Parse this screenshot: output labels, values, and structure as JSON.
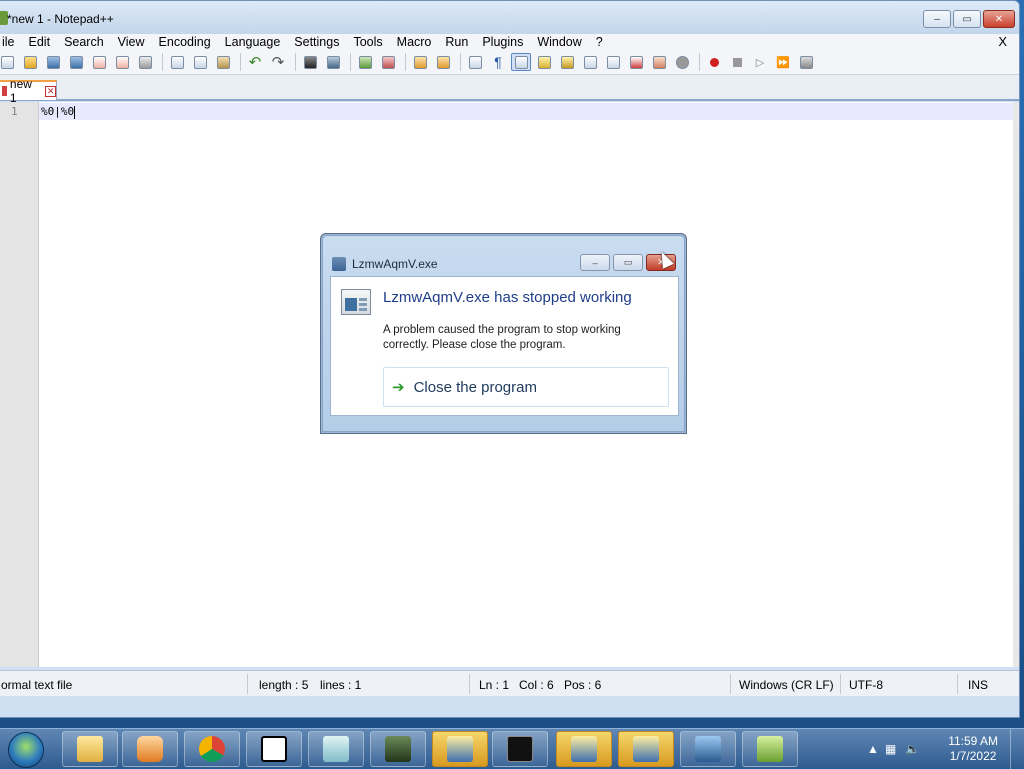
{
  "window": {
    "title": "*new 1 - Notepad++",
    "caption_buttons": {
      "minimize": "–",
      "maximize": "▭",
      "close": "✕"
    }
  },
  "menu": {
    "items": [
      "File",
      "Edit",
      "Search",
      "View",
      "Encoding",
      "Language",
      "Settings",
      "Tools",
      "Macro",
      "Run",
      "Plugins",
      "Window",
      "?"
    ],
    "visible_first": "ile",
    "close_label": "X"
  },
  "toolbar": {
    "icons": [
      "new-icon",
      "open-icon",
      "save-icon",
      "save-all-icon",
      "close-icon",
      "close-all-icon",
      "print-icon",
      "cut-icon",
      "copy-icon",
      "paste-icon",
      "undo-icon",
      "redo-icon",
      "find-icon",
      "replace-icon",
      "zoom-in-icon",
      "zoom-out-icon",
      "sync-v-icon",
      "sync-h-icon",
      "wrap-icon",
      "all-chars-icon",
      "indent-guide-icon",
      "udl-icon",
      "doc-map-icon",
      "function-list-icon",
      "folder-workspace-icon",
      "monitor-icon",
      "record-macro-icon",
      "stop-macro-icon",
      "play-macro-icon",
      "run-macro-multiple-icon",
      "save-macro-icon"
    ]
  },
  "tabs": [
    {
      "label": "new 1",
      "close": "✕"
    }
  ],
  "editor": {
    "line_number": "1",
    "content": "%0|%0"
  },
  "status": {
    "file_type": "ormal text file",
    "length": "length : 5",
    "lines": "lines : 1",
    "ln": "Ln : 1",
    "col": "Col : 6",
    "pos": "Pos : 6",
    "eol": "Windows (CR LF)",
    "encoding": "UTF-8",
    "mode": "INS"
  },
  "dialog": {
    "title": "LzmwAqmV.exe",
    "heading": "LzmwAqmV.exe has stopped working",
    "message": "A problem caused the program to stop working correctly. Please close the program.",
    "action": "Close the program",
    "caption_buttons": {
      "minimize": "–",
      "maximize": "▭",
      "close": "✕"
    }
  },
  "taskbar": {
    "apps": [
      "explorer-icon",
      "media-player-icon",
      "chrome-icon",
      "7zip-icon",
      "notepad-icon",
      "monitor-app-icon",
      "warning-app-icon",
      "cmd-icon",
      "warning-app-icon",
      "warning-app-icon",
      "network-icon",
      "notepadpp-icon"
    ],
    "time": "11:59 AM",
    "date": "1/7/2022"
  }
}
